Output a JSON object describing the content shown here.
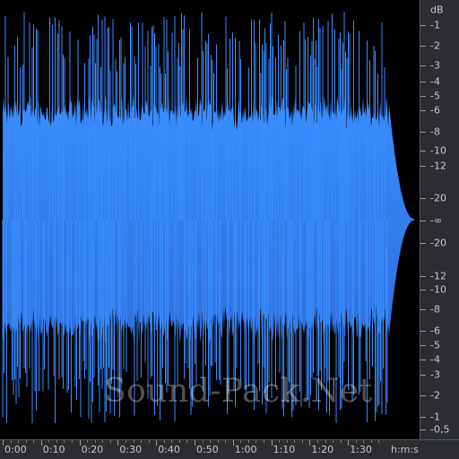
{
  "colors": {
    "wave_top": "#3a8dff",
    "wave_bottom": "#2e6fdc",
    "background": "#000000",
    "panel": "#2b2d30",
    "text": "#c8c8c8"
  },
  "db_scale": {
    "unit_label": "dB",
    "ticks": [
      "-1",
      "-2",
      "-3",
      "-4",
      "-5",
      "-6",
      "-8",
      "-10",
      "-12",
      "-20",
      "-∞",
      "-20",
      "-12",
      "-10",
      "-8",
      "-6",
      "-5",
      "-4",
      "-3",
      "-2",
      "-1",
      "-0,5"
    ]
  },
  "time_ruler": {
    "labels": [
      "0:00",
      "0:10",
      "0:20",
      "0:30",
      "0:40",
      "0:50",
      "1:00",
      "1:10",
      "1:20",
      "1:30"
    ],
    "unit_label": "h:m:s"
  },
  "watermark": "Sound-Pack.Net"
}
